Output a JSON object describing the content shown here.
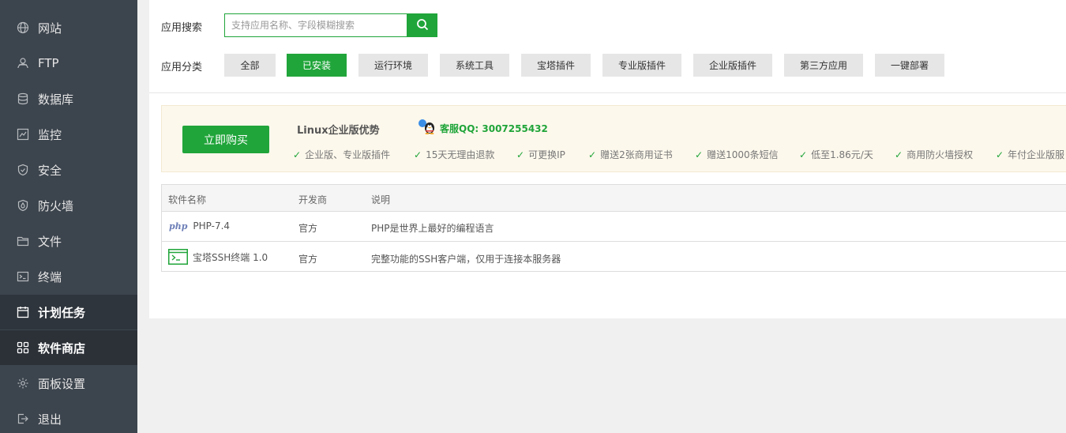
{
  "sidebar": {
    "items": [
      {
        "label": "网站",
        "icon": "globe-icon"
      },
      {
        "label": "FTP",
        "icon": "ftp-user-icon"
      },
      {
        "label": "数据库",
        "icon": "database-icon"
      },
      {
        "label": "监控",
        "icon": "monitor-chart-icon"
      },
      {
        "label": "安全",
        "icon": "shield-icon"
      },
      {
        "label": "防火墙",
        "icon": "firewall-icon"
      },
      {
        "label": "文件",
        "icon": "folder-icon"
      },
      {
        "label": "终端",
        "icon": "terminal-icon"
      },
      {
        "label": "计划任务",
        "icon": "calendar-icon"
      },
      {
        "label": "软件商店",
        "icon": "grid-apps-icon"
      },
      {
        "label": "面板设置",
        "icon": "gear-icon"
      },
      {
        "label": "退出",
        "icon": "logout-icon"
      }
    ]
  },
  "search": {
    "label": "应用搜索",
    "placeholder": "支持应用名称、字段模糊搜索"
  },
  "category": {
    "label": "应用分类",
    "items": [
      "全部",
      "已安装",
      "运行环境",
      "系统工具",
      "宝塔插件",
      "专业版插件",
      "企业版插件",
      "第三方应用",
      "一键部署"
    ],
    "active": "已安装"
  },
  "promo": {
    "buy_label": "立即购买",
    "title": "Linux企业版优势",
    "qq": "客服QQ: 3007255432",
    "features": [
      "企业版、专业版插件",
      "15天无理由退款",
      "可更换IP",
      "赠送2张商用证书",
      "赠送1000条短信",
      "低至1.86元/天",
      "商用防火墙授权",
      "年付企业版服"
    ]
  },
  "table": {
    "headers": [
      "软件名称",
      "开发商",
      "说明"
    ],
    "rows": [
      {
        "icon": "php-logo-icon",
        "name": "PHP-7.4",
        "vendor": "官方",
        "desc": "PHP是世界上最好的编程语言"
      },
      {
        "icon": "ssh-terminal-icon",
        "name": "宝塔SSH终端 1.0",
        "vendor": "官方",
        "desc": "完整功能的SSH客户端，仅用于连接本服务器"
      }
    ]
  },
  "colors": {
    "accent": "#20a53a",
    "sidebar_bg": "#3c444d",
    "promo_bg": "#fdf8ec"
  }
}
